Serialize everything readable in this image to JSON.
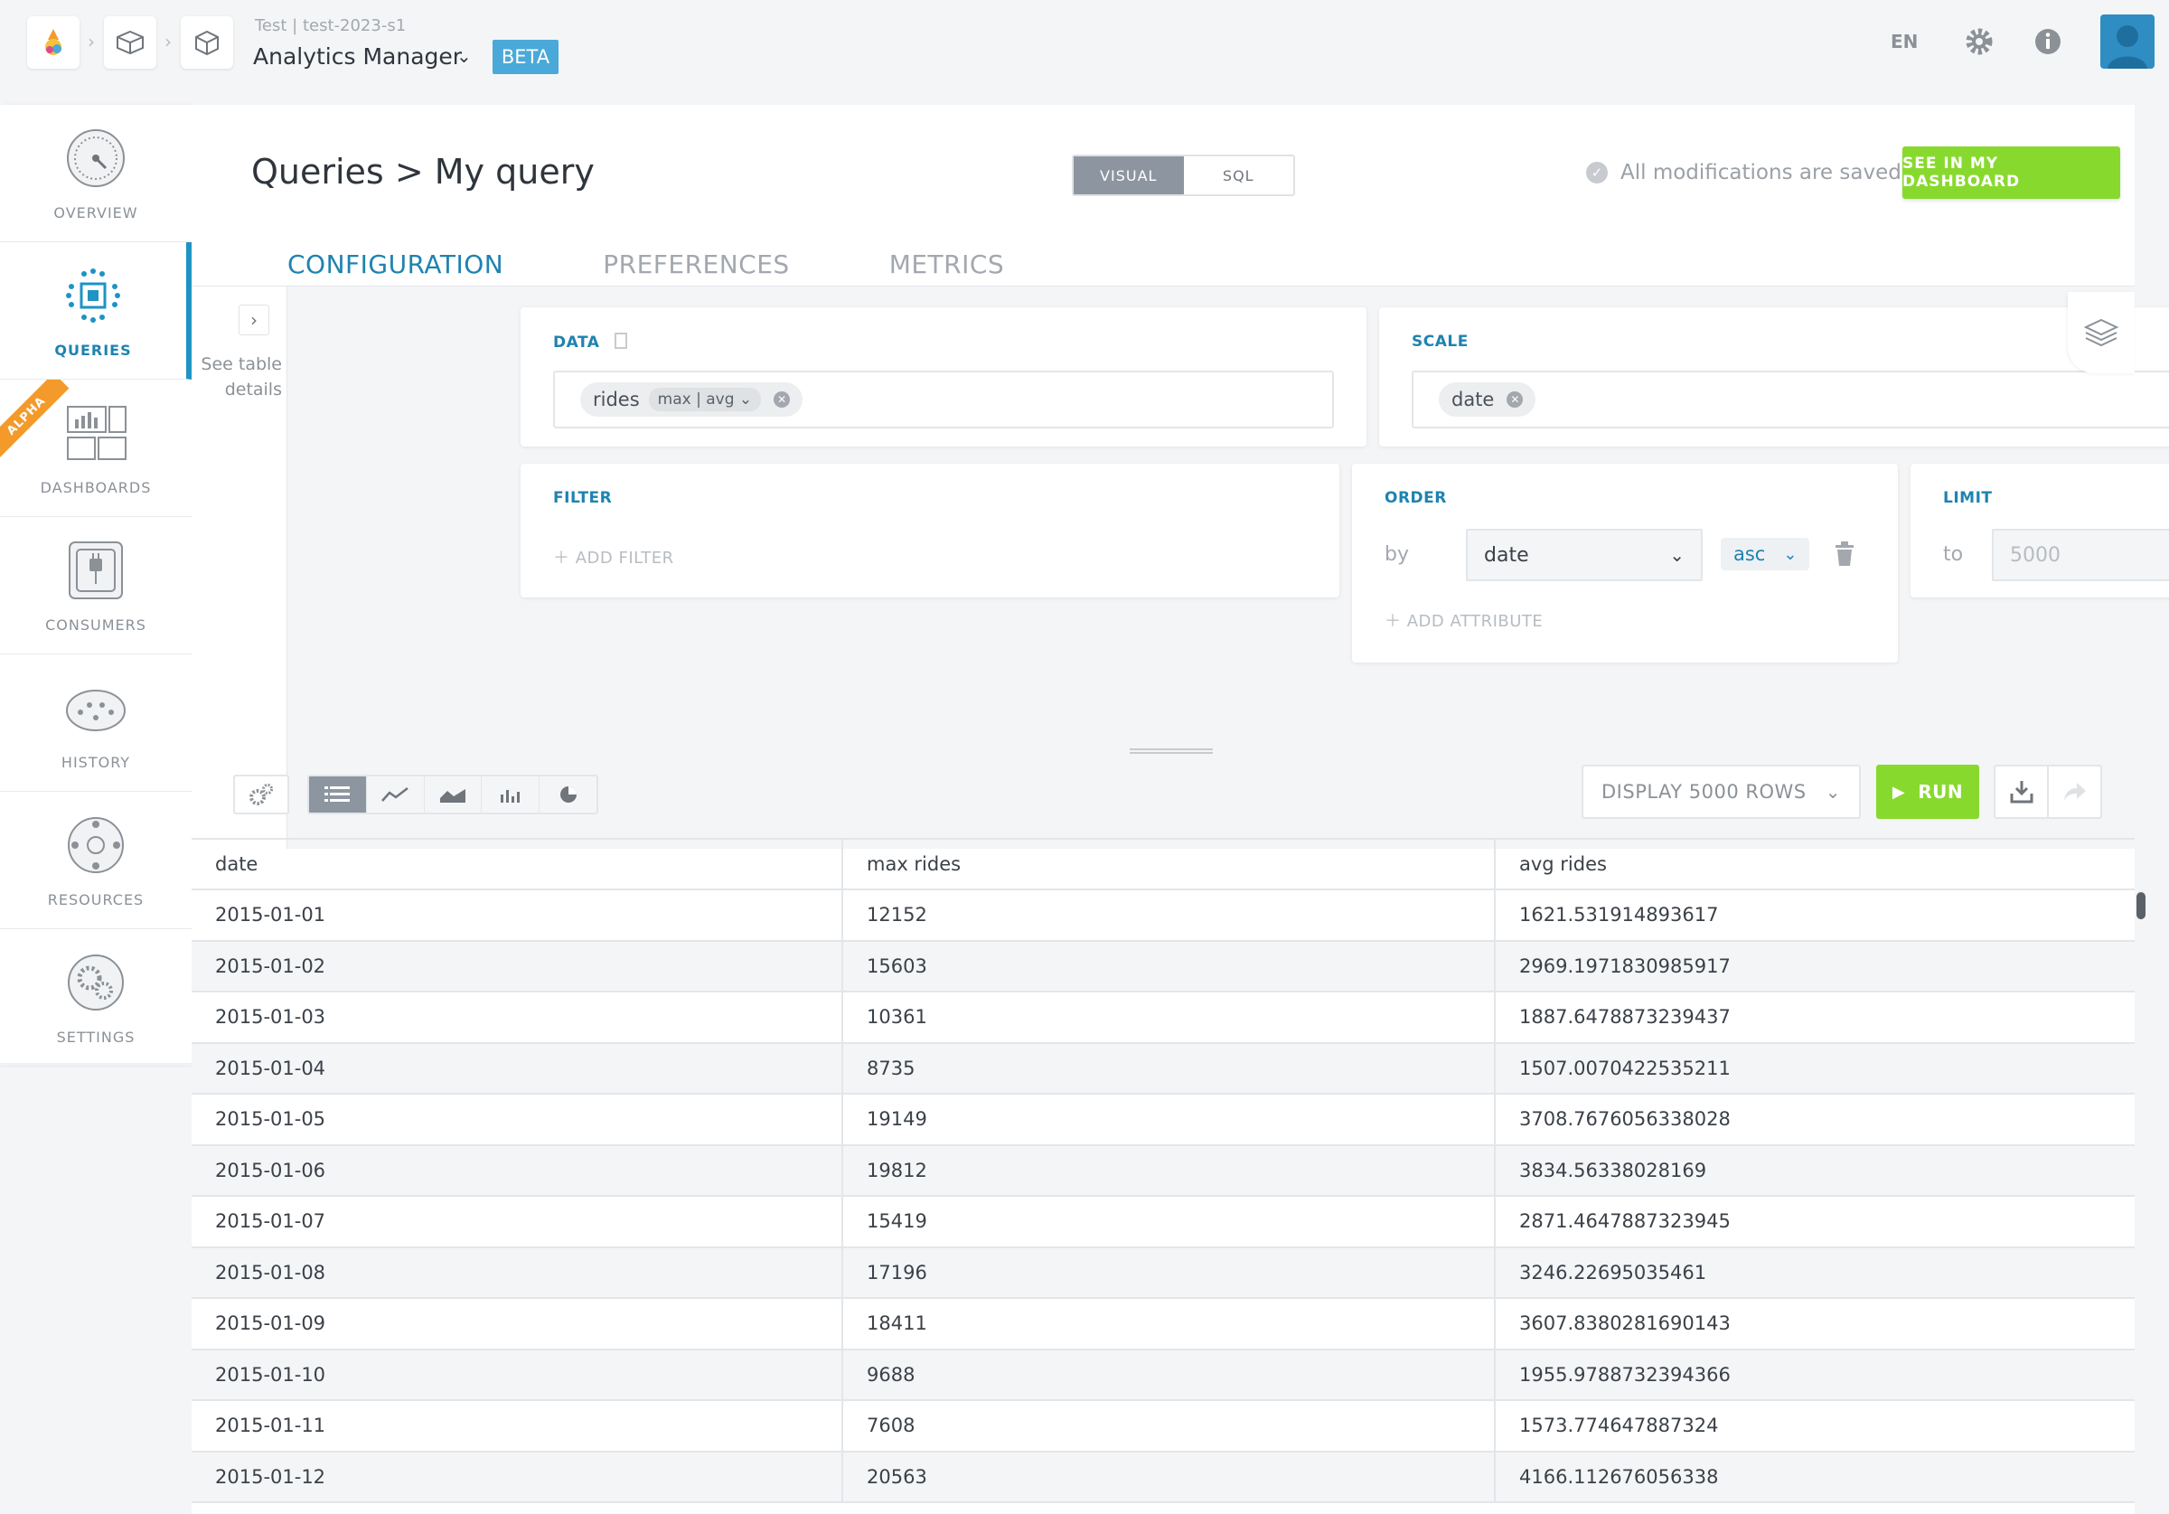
{
  "header": {
    "env_line": "Test | test-2023-s1",
    "app_title": "Analytics Manager",
    "beta_label": "BETA",
    "language": "EN"
  },
  "sidebar": {
    "alpha_label": "ALPHA",
    "items": [
      {
        "label": "OVERVIEW",
        "icon": "gauge-icon"
      },
      {
        "label": "QUERIES",
        "icon": "queries-icon",
        "active": true
      },
      {
        "label": "DASHBOARDS",
        "icon": "dashboards-icon"
      },
      {
        "label": "CONSUMERS",
        "icon": "plug-icon"
      },
      {
        "label": "HISTORY",
        "icon": "history-icon"
      },
      {
        "label": "RESOURCES",
        "icon": "resources-icon"
      },
      {
        "label": "SETTINGS",
        "icon": "gears-icon"
      }
    ]
  },
  "page": {
    "breadcrumb_root": "Queries",
    "breadcrumb_sep": ">",
    "breadcrumb_current": "My query",
    "mode_visual": "VISUAL",
    "mode_sql": "SQL",
    "saved_status": "All modifications are saved",
    "dashboard_button": "SEE IN MY DASHBOARD"
  },
  "tabs": [
    "CONFIGURATION",
    "PREFERENCES",
    "METRICS"
  ],
  "config": {
    "see_details": "See table details",
    "data": {
      "label": "DATA",
      "chip_name": "rides",
      "chip_aggs": "max | avg"
    },
    "scale": {
      "label": "SCALE",
      "chip_name": "date"
    },
    "filter": {
      "label": "FILTER",
      "add_label": "ADD FILTER"
    },
    "order": {
      "label": "ORDER",
      "by_label": "by",
      "field": "date",
      "direction": "asc",
      "add_label": "ADD ATTRIBUTE"
    },
    "limit": {
      "label": "LIMIT",
      "to_label": "to",
      "placeholder": "5000"
    }
  },
  "results": {
    "display_rows": "DISPLAY 5000 ROWS",
    "run_label": "RUN",
    "columns": [
      "date",
      "max rides",
      "avg rides"
    ],
    "rows": [
      [
        "2015-01-01",
        "12152",
        "1621.531914893617"
      ],
      [
        "2015-01-02",
        "15603",
        "2969.1971830985917"
      ],
      [
        "2015-01-03",
        "10361",
        "1887.6478873239437"
      ],
      [
        "2015-01-04",
        "8735",
        "1507.0070422535211"
      ],
      [
        "2015-01-05",
        "19149",
        "3708.7676056338028"
      ],
      [
        "2015-01-06",
        "19812",
        "3834.56338028169"
      ],
      [
        "2015-01-07",
        "15419",
        "2871.4647887323945"
      ],
      [
        "2015-01-08",
        "17196",
        "3246.22695035461"
      ],
      [
        "2015-01-09",
        "18411",
        "3607.8380281690143"
      ],
      [
        "2015-01-10",
        "9688",
        "1955.9788732394366"
      ],
      [
        "2015-01-11",
        "7608",
        "1573.774647887324"
      ],
      [
        "2015-01-12",
        "20563",
        "4166.112676056338"
      ]
    ]
  }
}
